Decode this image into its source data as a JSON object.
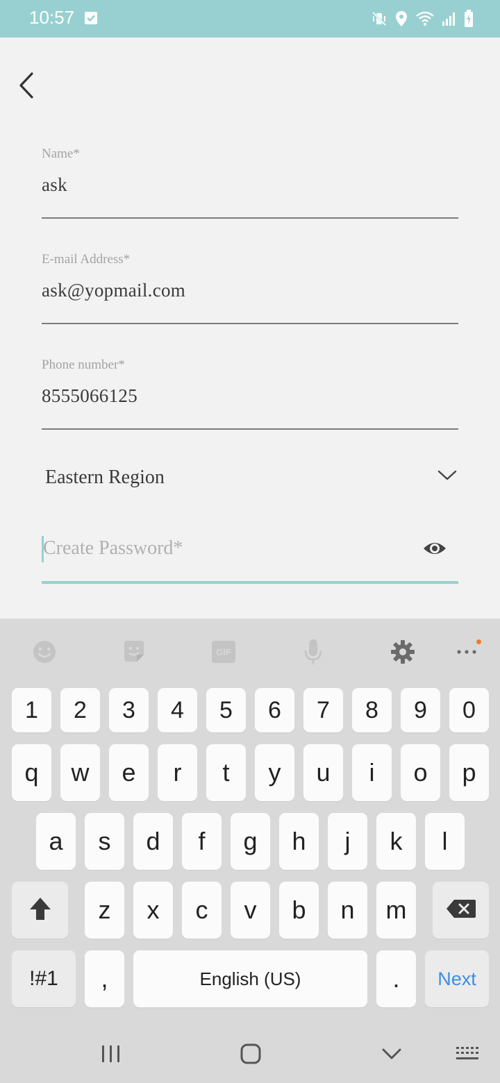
{
  "status_bar": {
    "time": "10:57",
    "icons": [
      "checkbox-icon",
      "mute-vibrate-icon",
      "location-icon",
      "wifi-icon",
      "signal-icon",
      "battery-charging-icon"
    ],
    "background": "#98d0d1"
  },
  "form": {
    "back_icon": "chevron-left-icon",
    "name": {
      "label": "Name*",
      "value": "ask"
    },
    "email": {
      "label": "E-mail Address*",
      "value": "ask@yopmail.com"
    },
    "phone": {
      "label": "Phone number*",
      "value": "8555066125"
    },
    "region": {
      "value": "Eastern Region",
      "icon": "chevron-down-icon"
    },
    "password": {
      "placeholder": "Create Password*",
      "icon": "eye-icon",
      "focused": true
    },
    "accent_color": "#98d0d1"
  },
  "keyboard": {
    "toolbar": [
      "emoji-icon",
      "sticker-icon",
      "gif-icon",
      "microphone-icon",
      "settings-gear-icon",
      "more-icon"
    ],
    "gif_label": "GIF",
    "row_numbers": [
      "1",
      "2",
      "3",
      "4",
      "5",
      "6",
      "7",
      "8",
      "9",
      "0"
    ],
    "row_top": [
      "q",
      "w",
      "e",
      "r",
      "t",
      "y",
      "u",
      "i",
      "o",
      "p"
    ],
    "row_middle": [
      "a",
      "s",
      "d",
      "f",
      "g",
      "h",
      "j",
      "k",
      "l"
    ],
    "row_bottom": [
      "z",
      "x",
      "c",
      "v",
      "b",
      "n",
      "m"
    ],
    "shift_icon": "shift-arrow-icon",
    "backspace_icon": "backspace-icon",
    "symbols_label": "!#1",
    "comma_label": ",",
    "space_label": "English (US)",
    "period_label": ".",
    "next_label": "Next",
    "next_color": "#3a8ee6"
  },
  "nav_bar": {
    "icons": [
      "recent-apps-icon",
      "home-icon",
      "back-down-icon",
      "keyboard-icon"
    ]
  }
}
